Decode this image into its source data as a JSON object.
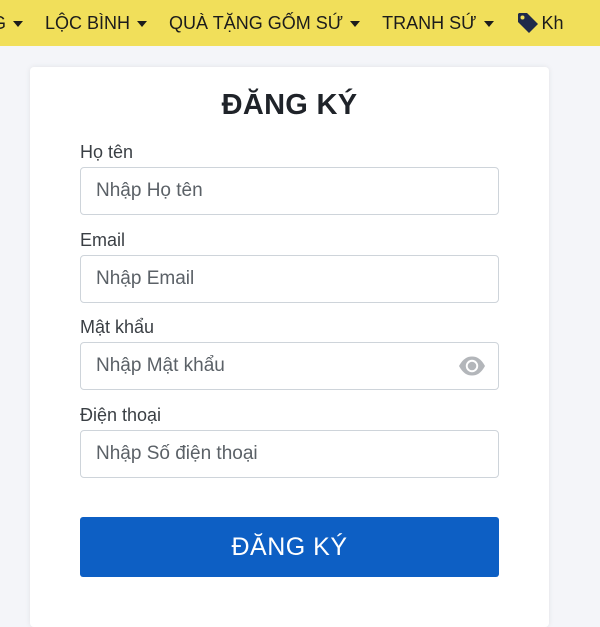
{
  "nav": {
    "items": [
      {
        "label": "G",
        "has_caret": true
      },
      {
        "label": "LỘC BÌNH",
        "has_caret": true
      },
      {
        "label": "QUÀ TẶNG GỐM SỨ",
        "has_caret": true
      },
      {
        "label": "TRANH SỨ",
        "has_caret": true
      },
      {
        "label": "Kh",
        "icon": "tag-icon"
      }
    ],
    "bg_color": "#f1df5a"
  },
  "form": {
    "title": "ĐĂNG KÝ",
    "fields": [
      {
        "label": "Họ tên",
        "placeholder": "Nhập Họ tên",
        "value": ""
      },
      {
        "label": "Email",
        "placeholder": "Nhập Email",
        "value": ""
      },
      {
        "label": "Mật khẩu",
        "placeholder": "Nhập Mật khẩu",
        "value": "",
        "icon": "eye-icon"
      },
      {
        "label": "Điện thoại",
        "placeholder": "Nhập Số điện thoại",
        "value": ""
      }
    ],
    "submit_label": "ĐĂNG KÝ",
    "submit_color": "#0d5fc4"
  }
}
